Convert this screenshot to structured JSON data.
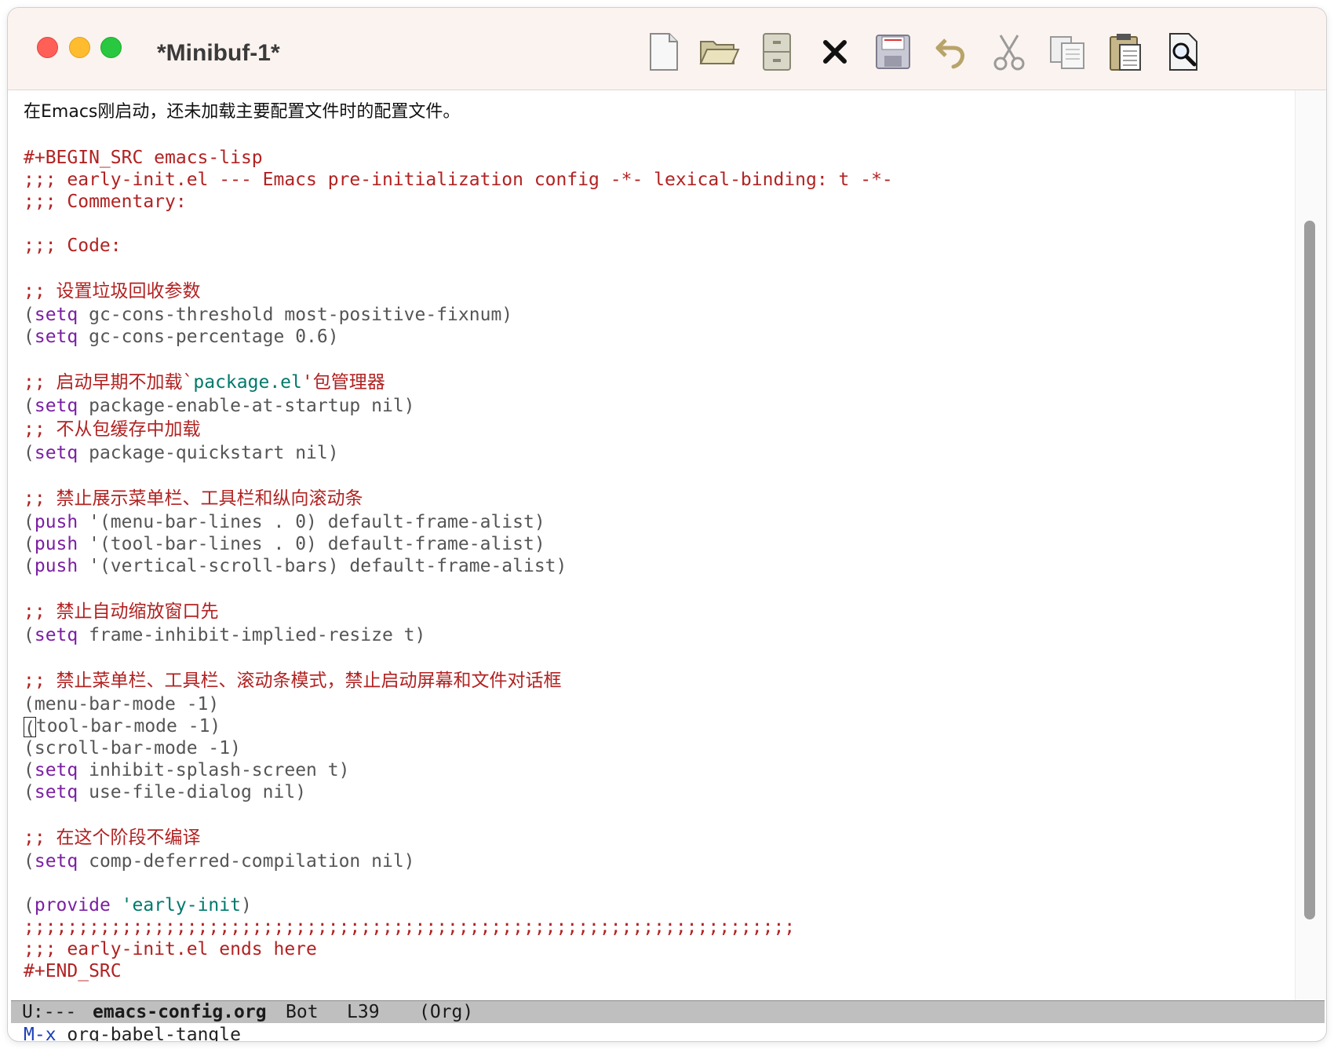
{
  "window": {
    "title": "*Minibuf-1*"
  },
  "toolbar": {
    "items": [
      {
        "name": "new-file-icon",
        "label": "New file"
      },
      {
        "name": "open-folder-icon",
        "label": "Open"
      },
      {
        "name": "file-cabinet-icon",
        "label": "Directory"
      },
      {
        "name": "close-icon",
        "label": "Close"
      },
      {
        "name": "save-icon",
        "label": "Save"
      },
      {
        "name": "undo-icon",
        "label": "Undo"
      },
      {
        "name": "cut-icon",
        "label": "Cut"
      },
      {
        "name": "copy-icon",
        "label": "Copy"
      },
      {
        "name": "paste-icon",
        "label": "Paste"
      },
      {
        "name": "search-icon",
        "label": "Search"
      }
    ]
  },
  "buffer": {
    "prose": "在Emacs刚启动，还未加载主要配置文件时的配置文件。",
    "begin_src": "#+BEGIN_SRC emacs-lisp",
    "header1": ";;; early-init.el --- Emacs pre-initialization config -*- lexical-binding: t -*-",
    "header2": ";;; Commentary:",
    "code_hdr": ";;; Code:",
    "c_gc": ";; 设置垃圾回收参数",
    "gc1_kw": "setq",
    "gc1_rest": " gc-cons-threshold most-positive-fixnum)",
    "gc2_kw": "setq",
    "gc2_rest": " gc-cons-percentage 0.6)",
    "c_pkg_a": ";; 启动早期不加载`",
    "c_pkg_b": "package.el",
    "c_pkg_c": "'包管理器",
    "pkg1_kw": "setq",
    "pkg1_rest": " package-enable-at-startup nil)",
    "c_cache": ";; 不从包缓存中加载",
    "pkg2_kw": "setq",
    "pkg2_rest": " package-quickstart nil)",
    "c_bars": ";; 禁止展示菜单栏、工具栏和纵向滚动条",
    "push1_kw": "push",
    "push1_rest": " '(menu-bar-lines . 0) default-frame-alist)",
    "push2_kw": "push",
    "push2_rest": " '(tool-bar-lines . 0) default-frame-alist)",
    "push3_kw": "push",
    "push3_rest": " '(vertical-scroll-bars) default-frame-alist)",
    "c_resize": ";; 禁止自动缩放窗口先",
    "frame_kw": "setq",
    "frame_rest": " frame-inhibit-implied-resize t)",
    "c_modes": ";; 禁止菜单栏、工具栏、滚动条模式，禁止启动屏幕和文件对话框",
    "mode1": "(menu-bar-mode -1)",
    "mode2_cursor": "(",
    "mode2_rest": "tool-bar-mode -1)",
    "mode3": "(scroll-bar-mode -1)",
    "splash_kw": "setq",
    "splash_rest": " inhibit-splash-screen t)",
    "dialog_kw": "setq",
    "dialog_rest": " use-file-dialog nil)",
    "c_comp": ";; 在这个阶段不编译",
    "comp_kw": "setq",
    "comp_rest": " comp-deferred-compilation nil)",
    "provide_kw": "provide",
    "provide_sym": "'early-init",
    "semis": ";;;;;;;;;;;;;;;;;;;;;;;;;;;;;;;;;;;;;;;;;;;;;;;;;;;;;;;;;;;;;;;;;;;;;;;",
    "ends": ";;; early-init.el ends here",
    "end_src": "#+END_SRC"
  },
  "modeline": {
    "status": "U:---",
    "buffer_name": "emacs-config.org",
    "position": "Bot",
    "line": "L39",
    "mode": "(Org)"
  },
  "minibuffer": {
    "prompt": "M-x",
    "input": "org-babel-tangle"
  },
  "colors": {
    "comment": "#b22222",
    "keyword": "#7b1fa2",
    "constant": "#00796b",
    "text": "#555555",
    "modeline_bg": "#bfbfbf",
    "titlebar_bg": "#fbf3ef"
  }
}
